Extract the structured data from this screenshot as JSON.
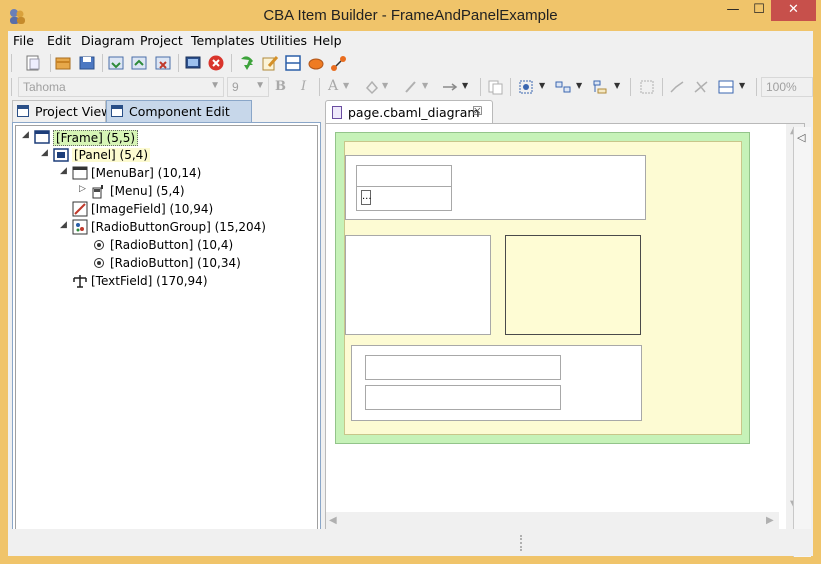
{
  "window": {
    "title": "CBA Item Builder - FrameAndPanelExample",
    "minimize": "—",
    "maximize": "☐",
    "close": "✕"
  },
  "menu": {
    "file": "File",
    "edit": "Edit",
    "diagram": "Diagram",
    "project": "Project",
    "templates": "Templates",
    "utilities": "Utilities",
    "help": "Help"
  },
  "toolbar": {
    "font_name": "Tahoma",
    "font_size": "9",
    "bold": "B",
    "italic": "I",
    "font_color": "A",
    "zoom": "100%"
  },
  "left_tabs": {
    "project_view": "Project View",
    "component_edit": "Component Edit"
  },
  "tree": [
    {
      "label": "[Frame] (5,5)",
      "twisty": "◢",
      "icon": "frame-icon",
      "selected": true
    },
    {
      "label": "[Panel] (5,4)",
      "twisty": "◢",
      "icon": "panel-icon"
    },
    {
      "label": "[MenuBar] (10,14)",
      "twisty": "◢",
      "icon": "menubar-icon"
    },
    {
      "label": "[Menu] (5,4)",
      "twisty": "▷",
      "icon": "menu-icon"
    },
    {
      "label": "[ImageField] (10,94)",
      "twisty": "",
      "icon": "image-field-icon"
    },
    {
      "label": "[RadioButtonGroup] (15,204)",
      "twisty": "◢",
      "icon": "radio-group-icon"
    },
    {
      "label": "[RadioButton] (10,4)",
      "twisty": "",
      "icon": "radio-button-icon"
    },
    {
      "label": "[RadioButton] (10,34)",
      "twisty": "",
      "icon": "radio-button-icon"
    },
    {
      "label": "[TextField] (170,94)",
      "twisty": "",
      "icon": "text-field-icon"
    }
  ],
  "editor": {
    "tab_label": "page.cbaml_diagram",
    "tab_close": "☒",
    "menu_ellipsis": "..."
  },
  "colors": {
    "titlebar": "#f0c46a",
    "close_button": "#c7504b",
    "frame_fill": "#c6f2b8",
    "panel_fill": "#fdfbd3",
    "selection_fill": "#d7f5b6",
    "active_tab": "#c7d7ea"
  }
}
